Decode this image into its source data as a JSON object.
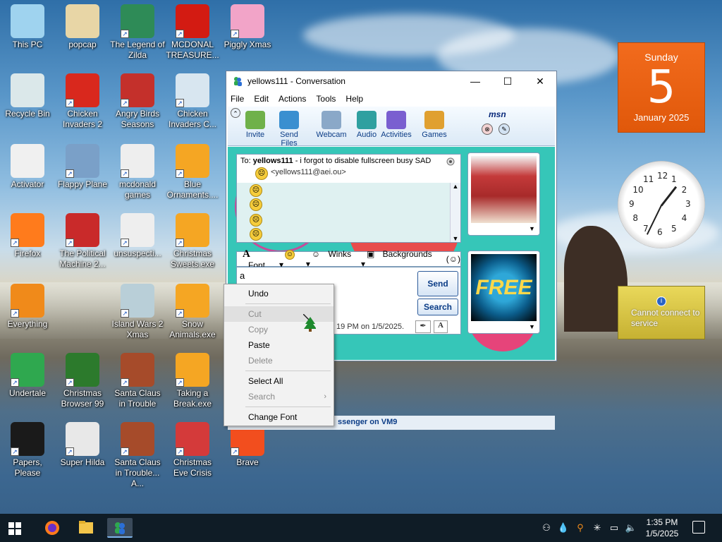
{
  "desktop": {
    "icons": [
      {
        "label": "This PC",
        "icon": "this-pc-icon",
        "color": "#9fd3ef"
      },
      {
        "label": "popcap",
        "icon": "popcap-icon",
        "color": "#e8d6a6"
      },
      {
        "label": "The Legend of Zilda",
        "icon": "legend-of-zilda-icon",
        "color": "#2e8b57"
      },
      {
        "label": "MCDONAL TREASURE...",
        "icon": "mcdonald-icon",
        "color": "#d31b12"
      },
      {
        "label": "Piggly Xmas",
        "icon": "piggly-xmas-icon",
        "color": "#f2a4c8"
      },
      {
        "label": "Recycle Bin",
        "icon": "recycle-bin-icon",
        "color": "#dbe8ea"
      },
      {
        "label": "Chicken Invaders 2",
        "icon": "chicken-invaders-2-icon",
        "color": "#d9281d"
      },
      {
        "label": "Angry Birds Seasons",
        "icon": "angry-birds-icon",
        "color": "#c4302b"
      },
      {
        "label": "Chicken Invaders C...",
        "icon": "chicken-invaders-c-icon",
        "color": "#d8e6f0"
      },
      {
        "label": "Activator",
        "icon": "activator-icon",
        "color": "#f0f0f0"
      },
      {
        "label": "Flappy Plane",
        "icon": "flappy-plane-icon",
        "color": "#7aa0c8"
      },
      {
        "label": "mcdonald games",
        "icon": "folder-icon",
        "color": "#eeeeee"
      },
      {
        "label": "Blue Ornaments....",
        "icon": "blue-ornaments-icon",
        "color": "#f5a623"
      },
      {
        "label": "Firefox",
        "icon": "firefox-icon",
        "color": "#ff7b1c"
      },
      {
        "label": "The Political Machine 2...",
        "icon": "political-machine-icon",
        "color": "#c92a2a"
      },
      {
        "label": "unsuspecti...",
        "icon": "folder-icon",
        "color": "#eeeeee"
      },
      {
        "label": "Christmas Sweets.exe",
        "icon": "christmas-sweets-icon",
        "color": "#f5a623"
      },
      {
        "label": "Everything",
        "icon": "everything-icon",
        "color": "#f08a1a"
      },
      {
        "label": "Island Wars 2 Xmas",
        "icon": "island-wars-icon",
        "color": "#b9cfd8"
      },
      {
        "label": "Snow Animals.exe",
        "icon": "snow-animals-icon",
        "color": "#f5a623"
      },
      {
        "label": "Undertale",
        "icon": "undertale-icon",
        "color": "#2fa84f"
      },
      {
        "label": "Christmas Browser 99",
        "icon": "christmas-browser-icon",
        "color": "#2c7a2c"
      },
      {
        "label": "Santa Claus in Trouble",
        "icon": "santa-claus-icon",
        "color": "#a64b2a"
      },
      {
        "label": "Taking a Break.exe",
        "icon": "taking-a-break-icon",
        "color": "#f5a623"
      },
      {
        "label": "Papers, Please",
        "icon": "papers-please-icon",
        "color": "#1a1a1a"
      },
      {
        "label": "Super Hilda",
        "icon": "super-hilda-icon",
        "color": "#e8e8e8"
      },
      {
        "label": "Santa Claus in Trouble... A...",
        "icon": "santa-claus-2-icon",
        "color": "#a64b2a"
      },
      {
        "label": "Christmas Eve Crisis",
        "icon": "christmas-eve-icon",
        "color": "#d43a3a"
      },
      {
        "label": "Brave",
        "icon": "brave-icon",
        "color": "#f24e1e"
      }
    ]
  },
  "widgets": {
    "calendar": {
      "weekday": "Sunday",
      "day": "5",
      "month_year": "January 2025"
    },
    "clock": {
      "numbers": [
        "12",
        "1",
        "2",
        "3",
        "4",
        "5",
        "6",
        "7",
        "8",
        "9",
        "10",
        "11"
      ]
    },
    "weather": {
      "message": "Cannot connect to service"
    }
  },
  "window": {
    "title": "yellows111 - Conversation",
    "controls": {
      "minimize": "—",
      "maximize": "☐",
      "close": "✕"
    },
    "menu": [
      "File",
      "Edit",
      "Actions",
      "Tools",
      "Help"
    ],
    "toolbar": [
      {
        "label": "Invite",
        "icon": "invite-icon"
      },
      {
        "label": "Send Files",
        "icon": "send-files-icon"
      },
      {
        "label": "Webcam",
        "icon": "webcam-icon"
      },
      {
        "label": "Audio",
        "icon": "audio-icon"
      },
      {
        "label": "Activities",
        "icon": "activities-icon"
      },
      {
        "label": "Games",
        "icon": "games-icon"
      }
    ],
    "brand": "msn",
    "to": {
      "prefix": "To:",
      "name": "yellows111",
      "status": " - i forgot to disable fullscreen busy SAD",
      "email": "<yellows111@aei.ou>"
    },
    "format_bar": {
      "font": "Font",
      "winks": "Winks",
      "backgrounds": "Backgrounds"
    },
    "compose_text": "a",
    "send_label": "Send",
    "search_label": "Search",
    "last_message": "19 PM on 1/5/2025.",
    "status_bar": "ssenger on VM9",
    "avatar_text": "FREE"
  },
  "context_menu": {
    "items": [
      {
        "label": "Undo",
        "disabled": false
      },
      {
        "label": "Cut",
        "disabled": true
      },
      {
        "label": "Copy",
        "disabled": true
      },
      {
        "label": "Paste",
        "disabled": false
      },
      {
        "label": "Delete",
        "disabled": true
      },
      {
        "label": "Select All",
        "disabled": false
      },
      {
        "label": "Search",
        "disabled": true
      },
      {
        "label": "Change Font",
        "disabled": false
      }
    ]
  },
  "taskbar": {
    "time": "1:35 PM",
    "date": "1/5/2025"
  },
  "colors": {
    "accent": "#0b3c86",
    "taskbar": "#0f1c26",
    "calendar": "#e0580a",
    "chat_bg": "#36c6b8"
  }
}
